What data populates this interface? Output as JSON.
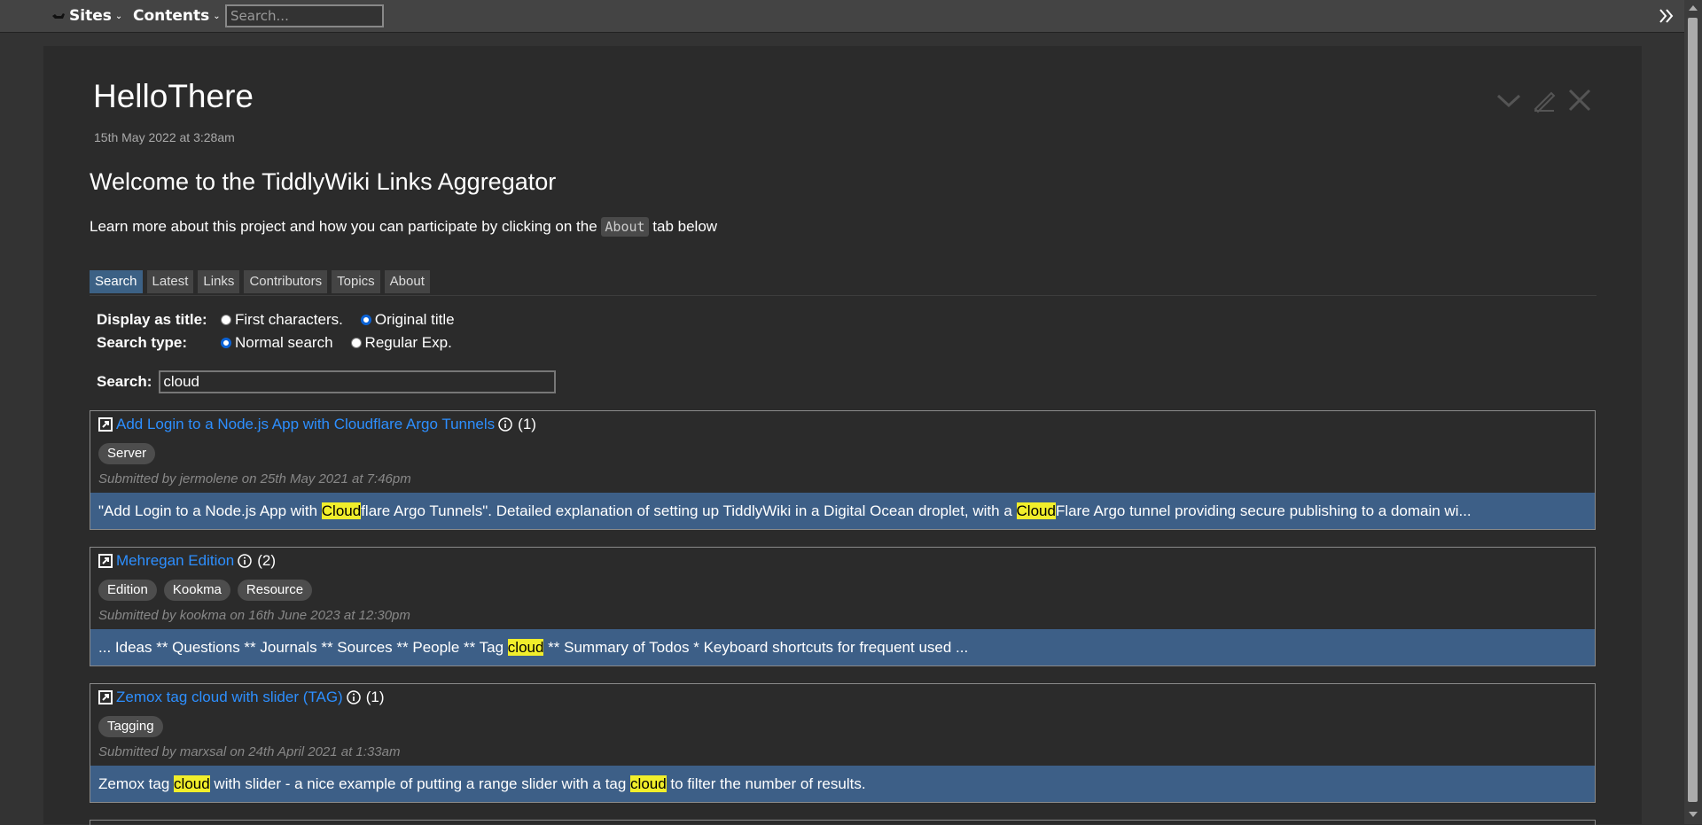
{
  "topbar": {
    "sites_label": "Sites",
    "contents_label": "Contents",
    "search_placeholder": "Search..."
  },
  "tiddler": {
    "title": "HelloThere",
    "date": "15th May 2022 at 3:28am",
    "heading": "Welcome to the TiddlyWiki Links Aggregator",
    "intro_before": "Learn more about this project and how you can participate by clicking on the ",
    "intro_code": "About",
    "intro_after": " tab below"
  },
  "tabs": [
    {
      "label": "Search",
      "active": true
    },
    {
      "label": "Latest"
    },
    {
      "label": "Links"
    },
    {
      "label": "Contributors"
    },
    {
      "label": "Topics"
    },
    {
      "label": "About"
    }
  ],
  "options": {
    "display_label": "Display as title:",
    "display_opt1": "First characters.",
    "display_opt2": "Original title",
    "type_label": "Search type:",
    "type_opt1": "Normal search",
    "type_opt2": "Regular Exp.",
    "search_label": "Search:",
    "search_value": "cloud"
  },
  "results": [
    {
      "title": "Add Login to a Node.js App with Cloudflare Argo Tunnels",
      "count": "(1)",
      "tags": [
        "Server"
      ],
      "submitted": "Submitted by jermolene on 25th May 2021 at 7:46pm",
      "body": [
        {
          "t": "\"Add Login to a Node.js App with "
        },
        {
          "t": "Cloud",
          "hl": true
        },
        {
          "t": "flare Argo Tunnels\". Detailed explanation of setting up TiddlyWiki in a Digital Ocean droplet, with a "
        },
        {
          "t": "Cloud",
          "hl": true
        },
        {
          "t": "Flare Argo tunnel providing secure publishing to a domain wi..."
        }
      ]
    },
    {
      "title": "Mehregan Edition",
      "count": "(2)",
      "tags": [
        "Edition",
        "Kookma",
        "Resource"
      ],
      "submitted": "Submitted by kookma on 16th June 2023 at 12:30pm",
      "body": [
        {
          "t": "... Ideas ** Questions ** Journals ** Sources ** People ** Tag "
        },
        {
          "t": "cloud",
          "hl": true
        },
        {
          "t": " ** Summary of Todos * Keyboard shortcuts for frequent used ..."
        }
      ]
    },
    {
      "title": "Zemox tag cloud with slider (TAG)",
      "count": "(1)",
      "tags": [
        "Tagging"
      ],
      "submitted": "Submitted by marxsal on 24th April 2021 at 1:33am",
      "body": [
        {
          "t": "Zemox tag "
        },
        {
          "t": "cloud",
          "hl": true
        },
        {
          "t": " with slider - a nice example of putting a range slider with a tag "
        },
        {
          "t": "cloud",
          "hl": true
        },
        {
          "t": " to filter the number of results."
        }
      ]
    }
  ],
  "colors": {
    "link": "#2d8fff",
    "highlight": "#f1ee2b",
    "result_body_bg": "#3d5f87",
    "active_tab": "#3c6185"
  }
}
